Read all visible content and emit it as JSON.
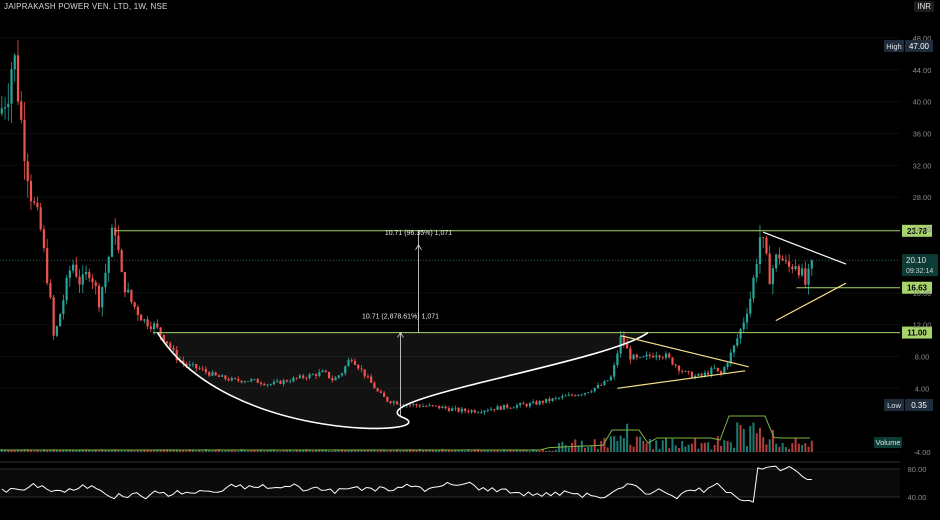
{
  "header": {
    "title": "JAIPRAKASH POWER VEN. LTD, 1W, NSE",
    "currency": "INR"
  },
  "price_axis": {
    "ticks": [
      "48.00",
      "44.00",
      "40.00",
      "36.00",
      "32.00",
      "28.00",
      "24.00",
      "20.00",
      "16.00",
      "12.00",
      "8.00",
      "4.00",
      "-4.00"
    ]
  },
  "markers": {
    "high": {
      "label": "High",
      "value": "47.00"
    },
    "low": {
      "label": "Low",
      "value": "0.35"
    },
    "last": {
      "value": "20.10",
      "countdown": "09:32:14"
    },
    "level_2378": "23.78",
    "level_1663": "16.63",
    "level_1100": "11.00"
  },
  "annotations": {
    "measure_bottom": "10.71 (2,878.61%) 1,071",
    "measure_top": "10.71 (96.35%) 1,071"
  },
  "volume": {
    "label": "Volume"
  },
  "rsi": {
    "ticks": [
      "80.00",
      "40.00"
    ]
  },
  "colors": {
    "up": "#26a69a",
    "down": "#ef5350",
    "level": "#a6d36a",
    "triangle": "#f5e08a",
    "bowl": "#ffffff",
    "rsi": "#ffffff",
    "vol_ma": "#7cb342"
  },
  "chart_data": {
    "type": "line",
    "title": "JAIPRAKASH POWER VEN. LTD, 1W, NSE",
    "ylim": [
      -4,
      49
    ],
    "x_range": [
      0,
      100
    ],
    "series": [
      {
        "values": [
          [
            0,
            38.5
          ],
          [
            1,
            42
          ],
          [
            1.5,
            46.5
          ],
          [
            2.5,
            36
          ],
          [
            3.5,
            28
          ],
          [
            4.5,
            24
          ],
          [
            5.5,
            16
          ],
          [
            6,
            10
          ],
          [
            7,
            15
          ],
          [
            8,
            20
          ],
          [
            9,
            17
          ],
          [
            10,
            19
          ],
          [
            11,
            15
          ],
          [
            12,
            20
          ],
          [
            12.7,
            25
          ],
          [
            13.5,
            18
          ],
          [
            14.5,
            15
          ],
          [
            16,
            12.5
          ],
          [
            17,
            12
          ],
          [
            18.5,
            10
          ],
          [
            19.5,
            8
          ],
          [
            20.5,
            7
          ],
          [
            22,
            6.5
          ],
          [
            24,
            5.5
          ],
          [
            26,
            5
          ],
          [
            28,
            5
          ],
          [
            30,
            4.5
          ],
          [
            32,
            5
          ],
          [
            34,
            5.5
          ],
          [
            36,
            6
          ],
          [
            37,
            5
          ],
          [
            38,
            6
          ],
          [
            39,
            8
          ],
          [
            40,
            6.5
          ],
          [
            41,
            5
          ],
          [
            42,
            3.5
          ],
          [
            43,
            2.5
          ],
          [
            45,
            2
          ],
          [
            47,
            1.8
          ],
          [
            49,
            1.6
          ],
          [
            51,
            1.2
          ],
          [
            53,
            1.2
          ],
          [
            55,
            1.5
          ],
          [
            57,
            1.8
          ],
          [
            59,
            2
          ],
          [
            61,
            2.5
          ],
          [
            63,
            3
          ],
          [
            65,
            3.5
          ],
          [
            67,
            4.5
          ],
          [
            68,
            5.5
          ],
          [
            69,
            10.5
          ],
          [
            70,
            8
          ],
          [
            71,
            7.5
          ],
          [
            72,
            8
          ],
          [
            73,
            8.5
          ],
          [
            74,
            8
          ],
          [
            75,
            7
          ],
          [
            76,
            6
          ],
          [
            77,
            5.5
          ],
          [
            78,
            5.6
          ],
          [
            79.5,
            6.5
          ],
          [
            80,
            5.5
          ],
          [
            81.5,
            9
          ],
          [
            82.5,
            12
          ],
          [
            83.5,
            16
          ],
          [
            84.5,
            23.5
          ],
          [
            85.5,
            18
          ],
          [
            86.5,
            21
          ],
          [
            87.5,
            19
          ],
          [
            88.5,
            20
          ],
          [
            89.5,
            17
          ],
          [
            90.5,
            20.1
          ]
        ]
      }
    ],
    "lines": [
      {
        "y": 23.78
      },
      {
        "y": 16.63
      },
      {
        "y": 11.0
      }
    ],
    "yticks": [
      48,
      44,
      40,
      36,
      32,
      28,
      24,
      20,
      16,
      12,
      8,
      4,
      -4
    ],
    "high": 47.0,
    "low": 0.35,
    "last": 20.1
  }
}
